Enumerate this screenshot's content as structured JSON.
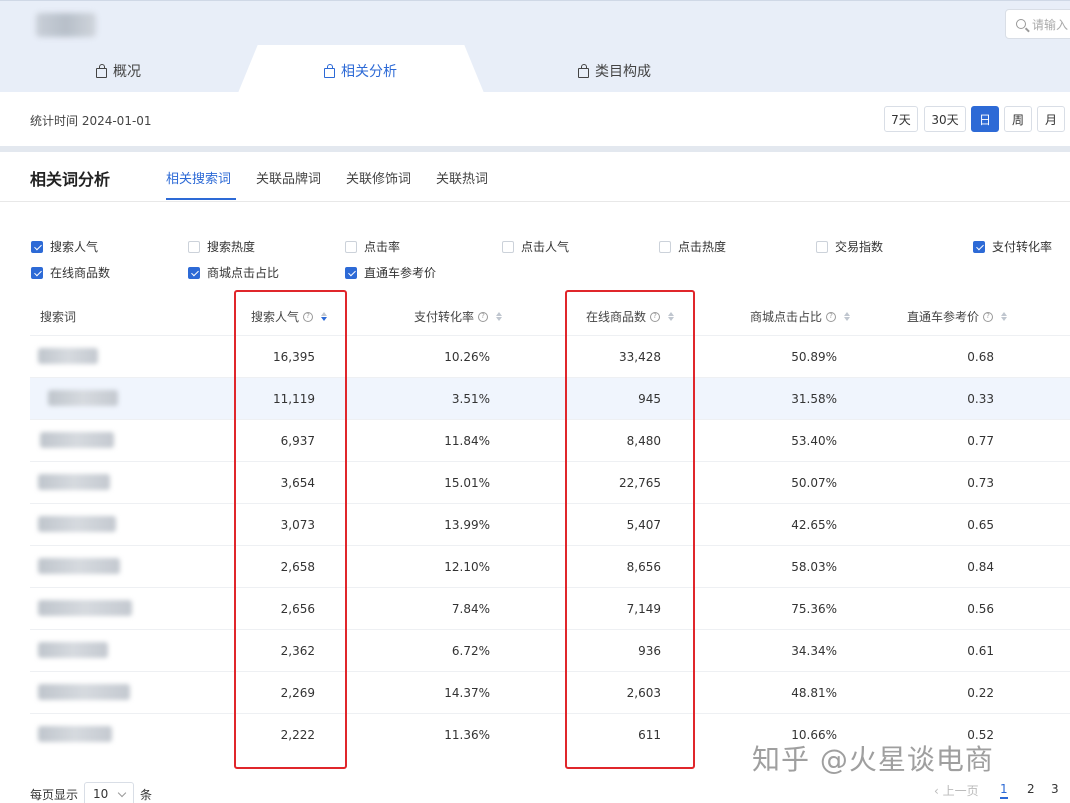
{
  "header": {
    "search_placeholder": "请输入",
    "tabs": [
      {
        "label": "概况"
      },
      {
        "label": "相关分析"
      },
      {
        "label": "类目构成"
      }
    ]
  },
  "stat_bar": {
    "time_text": "统计时间 2024-01-01",
    "periods": [
      "7天",
      "30天",
      "日",
      "周",
      "月"
    ],
    "active_period": "日"
  },
  "card": {
    "title": "相关词分析",
    "subtabs": [
      "相关搜索词",
      "关联品牌词",
      "关联修饰词",
      "关联热词"
    ],
    "active_subtab": "相关搜索词"
  },
  "metrics": [
    {
      "label": "搜索人气",
      "checked": true
    },
    {
      "label": "搜索热度",
      "checked": false
    },
    {
      "label": "点击率",
      "checked": false
    },
    {
      "label": "点击人气",
      "checked": false
    },
    {
      "label": "点击热度",
      "checked": false
    },
    {
      "label": "交易指数",
      "checked": false
    },
    {
      "label": "支付转化率",
      "checked": true
    },
    {
      "label": "在线商品数",
      "checked": true
    },
    {
      "label": "商城点击占比",
      "checked": true
    },
    {
      "label": "直通车参考价",
      "checked": true
    }
  ],
  "table": {
    "columns": [
      "搜索词",
      "搜索人气",
      "支付转化率",
      "在线商品数",
      "商城点击占比",
      "直通车参考价"
    ],
    "rows": [
      [
        "16,395",
        "10.26%",
        "33,428",
        "50.89%",
        "0.68"
      ],
      [
        "11,119",
        "3.51%",
        "945",
        "31.58%",
        "0.33"
      ],
      [
        "6,937",
        "11.84%",
        "8,480",
        "53.40%",
        "0.77"
      ],
      [
        "3,654",
        "15.01%",
        "22,765",
        "50.07%",
        "0.73"
      ],
      [
        "3,073",
        "13.99%",
        "5,407",
        "42.65%",
        "0.65"
      ],
      [
        "2,658",
        "12.10%",
        "8,656",
        "58.03%",
        "0.84"
      ],
      [
        "2,656",
        "7.84%",
        "7,149",
        "75.36%",
        "0.56"
      ],
      [
        "2,362",
        "6.72%",
        "936",
        "34.34%",
        "0.61"
      ],
      [
        "2,269",
        "14.37%",
        "2,603",
        "48.81%",
        "0.22"
      ],
      [
        "2,222",
        "11.36%",
        "611",
        "10.66%",
        "0.52"
      ]
    ]
  },
  "footer": {
    "per_page_label": "每页显示",
    "per_page_value": "10",
    "per_page_unit": "条",
    "prev_label": "上一页",
    "pages": [
      "1",
      "2",
      "3"
    ]
  },
  "watermark": "知乎 @火星谈电商",
  "colors": {
    "accent": "#2d6ad6",
    "highlight": "#e0262b"
  }
}
